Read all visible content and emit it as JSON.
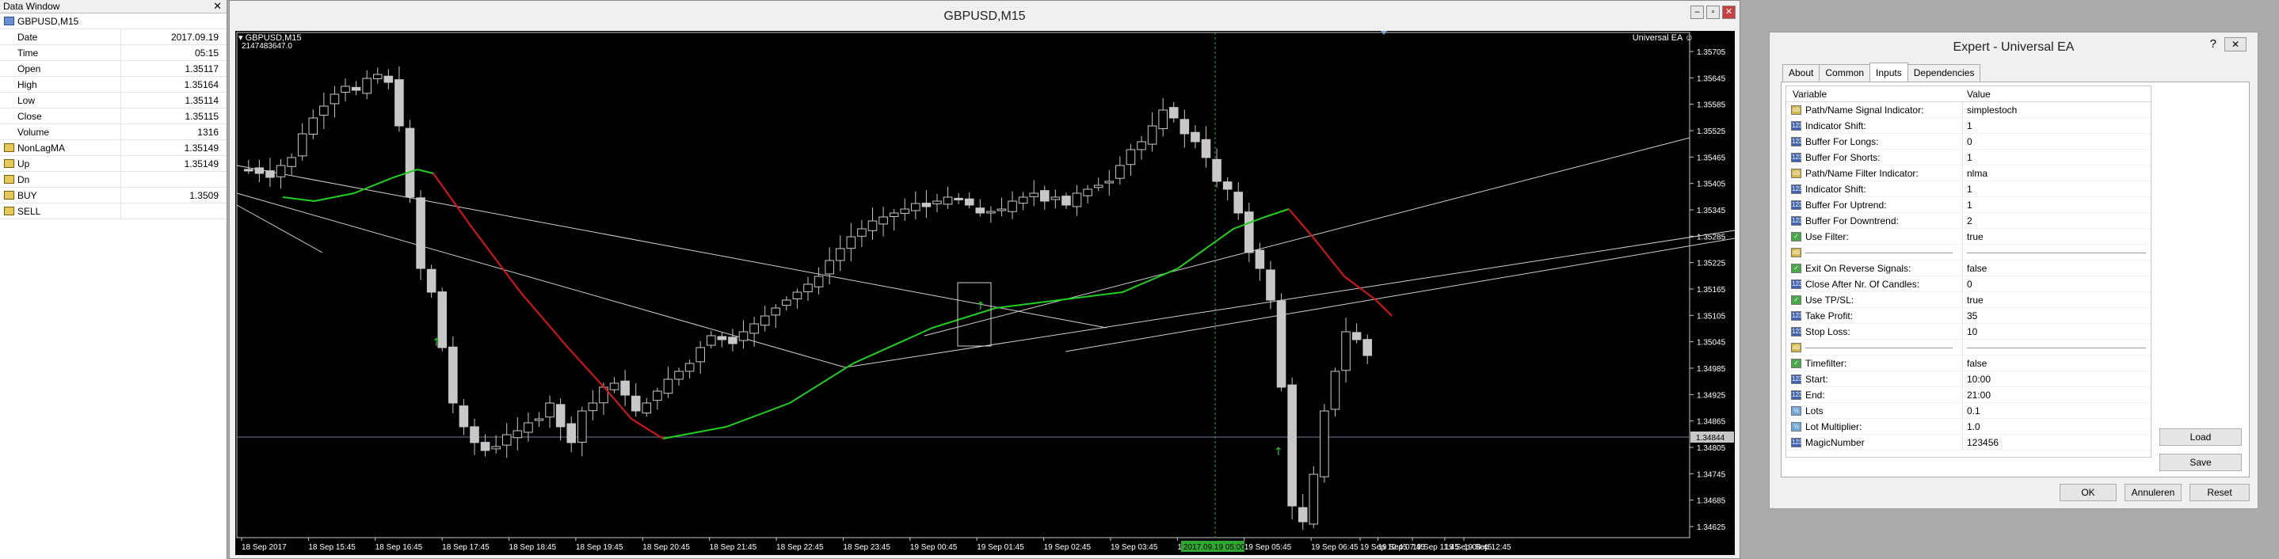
{
  "data_window": {
    "title": "Data Window",
    "symbol": "GBPUSD,M15",
    "rows": [
      {
        "label": "Date",
        "value": "2017.09.19",
        "icon": ""
      },
      {
        "label": "Time",
        "value": "05:15",
        "icon": ""
      },
      {
        "label": "Open",
        "value": "1.35117",
        "icon": ""
      },
      {
        "label": "High",
        "value": "1.35164",
        "icon": ""
      },
      {
        "label": "Low",
        "value": "1.35114",
        "icon": ""
      },
      {
        "label": "Close",
        "value": "1.35115",
        "icon": ""
      },
      {
        "label": "Volume",
        "value": "1316",
        "icon": ""
      },
      {
        "label": "NonLagMA",
        "value": "1.35149",
        "icon": "indicator-icon"
      },
      {
        "label": "Up",
        "value": "1.35149",
        "icon": "indicator-icon"
      },
      {
        "label": "Dn",
        "value": "",
        "icon": "indicator-icon"
      },
      {
        "label": "BUY",
        "value": "1.3509",
        "icon": "indicator-icon"
      },
      {
        "label": "SELL",
        "value": "",
        "icon": "indicator-icon"
      }
    ]
  },
  "chart_window": {
    "title": "GBPUSD,M15",
    "info_symbol": "GBPUSD,M15",
    "info_id": "2147483647.0",
    "ea_label": "Universal EA",
    "current_price": "1.34844",
    "date_highlight": "2017.09.19 05:00",
    "price_ticks": [
      "1.35705",
      "1.35645",
      "1.35585",
      "1.35525",
      "1.35465",
      "1.35405",
      "1.35345",
      "1.35285",
      "1.35225",
      "1.35165",
      "1.35105",
      "1.35045",
      "1.34985",
      "1.34925",
      "1.34865",
      "1.34805",
      "1.34745",
      "1.34685",
      "1.34625"
    ],
    "time_ticks": [
      "18 Sep 2017",
      "18 Sep 15:45",
      "18 Sep 16:45",
      "18 Sep 17:45",
      "18 Sep 18:45",
      "18 Sep 19:45",
      "18 Sep 20:45",
      "18 Sep 21:45",
      "18 Sep 22:45",
      "18 Sep 23:45",
      "19 Sep 00:45",
      "19 Sep 01:45",
      "19 Sep 02:45",
      "19 Sep 03:45",
      "19 Sep 04:45",
      "19 Sep 05:45",
      "19 Sep 06:45",
      "19 Sep 07:45",
      "19 Sep 08:45",
      "19 Sep 10:45",
      "19 Sep 11:45",
      "19 Sep 12:45"
    ]
  },
  "expert_dialog": {
    "title": "Expert - Universal EA",
    "help": "?",
    "close": "✕",
    "tabs": [
      "About",
      "Common",
      "Inputs",
      "Dependencies"
    ],
    "active_tab": "Inputs",
    "col_variable": "Variable",
    "col_value": "Value",
    "params": [
      {
        "type": "str",
        "name": "Path/Name Signal Indicator:",
        "value": "simplestoch"
      },
      {
        "type": "int",
        "name": "Indicator Shift:",
        "value": "1"
      },
      {
        "type": "int",
        "name": "Buffer For Longs:",
        "value": "0"
      },
      {
        "type": "int",
        "name": "Buffer For Shorts:",
        "value": "1"
      },
      {
        "type": "str",
        "name": "Path/Name Filter Indicator:",
        "value": "nlma"
      },
      {
        "type": "int",
        "name": "Indicator Shift:",
        "value": "1"
      },
      {
        "type": "int",
        "name": "Buffer For Uptrend:",
        "value": "1"
      },
      {
        "type": "int",
        "name": "Buffer For Downtrend:",
        "value": "2"
      },
      {
        "type": "bool",
        "name": "Use Filter:",
        "value": "true"
      },
      {
        "type": "str",
        "name": "",
        "value": "",
        "separator": true
      },
      {
        "type": "bool",
        "name": "Exit On Reverse Signals:",
        "value": "false"
      },
      {
        "type": "int",
        "name": "Close After Nr. Of Candles:",
        "value": "0"
      },
      {
        "type": "bool",
        "name": "Use TP/SL:",
        "value": "true"
      },
      {
        "type": "int",
        "name": "Take Profit:",
        "value": "35"
      },
      {
        "type": "int",
        "name": "Stop Loss:",
        "value": "10"
      },
      {
        "type": "str",
        "name": "",
        "value": "",
        "separator": true
      },
      {
        "type": "bool",
        "name": "Timefilter:",
        "value": "false"
      },
      {
        "type": "int",
        "name": "Start:",
        "value": "10:00"
      },
      {
        "type": "int",
        "name": "End:",
        "value": "21:00"
      },
      {
        "type": "dbl",
        "name": "Lots",
        "value": "0.1"
      },
      {
        "type": "dbl",
        "name": "Lot Multiplier:",
        "value": "1.0"
      },
      {
        "type": "int",
        "name": "MagicNumber",
        "value": "123456"
      }
    ],
    "load_label": "Load",
    "save_label": "Save",
    "ok_label": "OK",
    "cancel_label": "Annuleren",
    "reset_label": "Reset"
  }
}
